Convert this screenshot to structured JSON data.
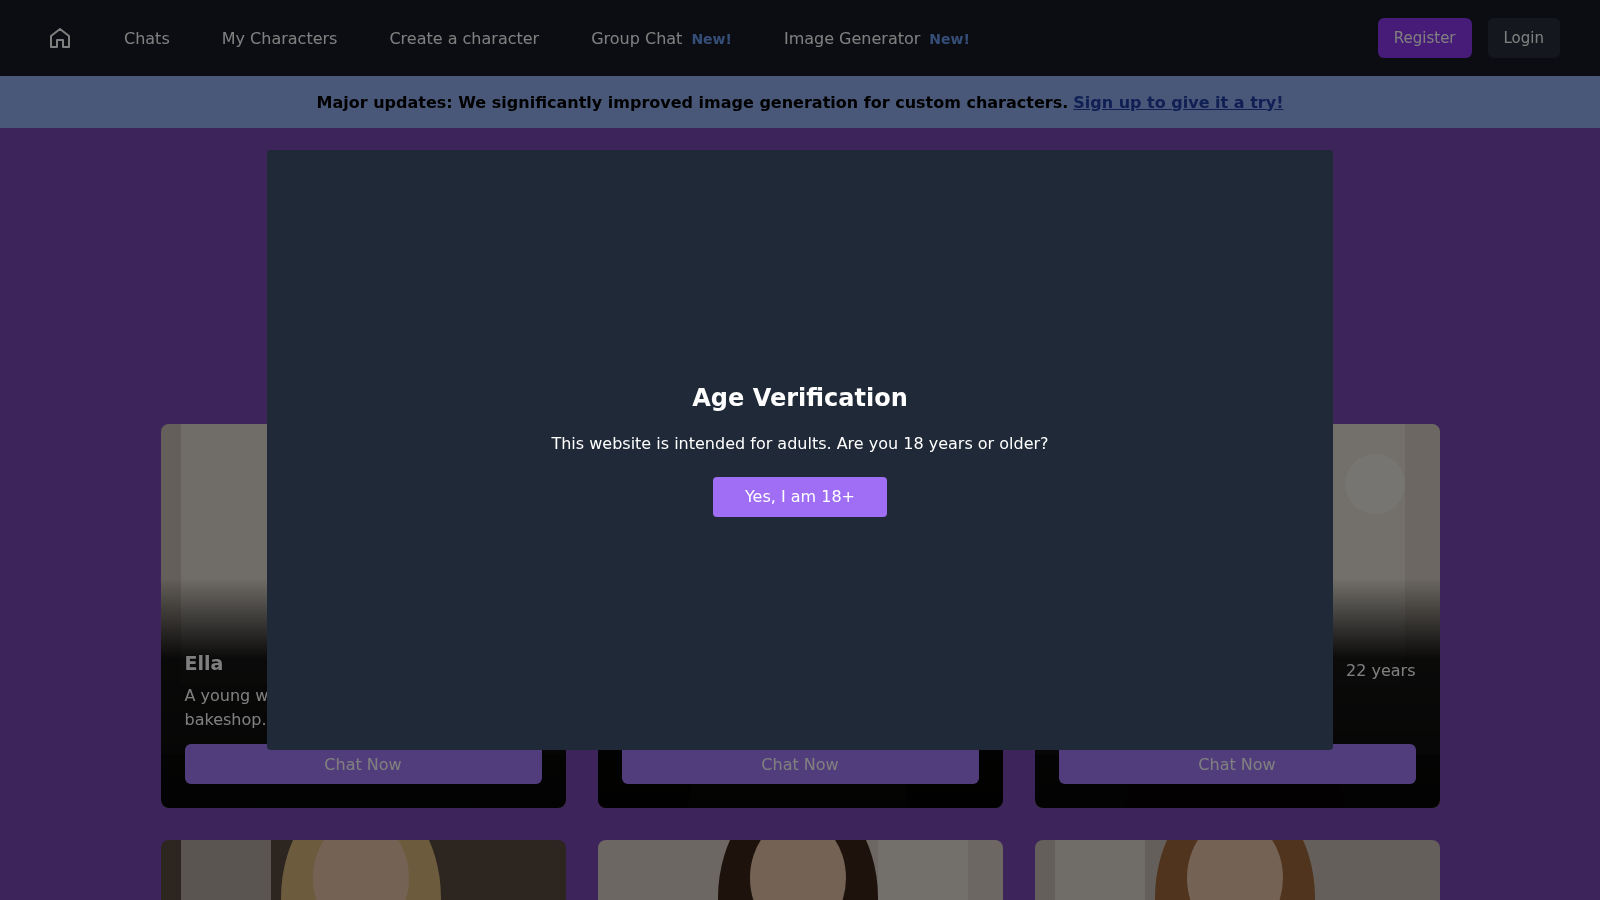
{
  "nav": {
    "links": [
      {
        "label": "Chats"
      },
      {
        "label": "My Characters"
      },
      {
        "label": "Create a character"
      },
      {
        "label": "Group Chat",
        "badge": "New!"
      },
      {
        "label": "Image Generator",
        "badge": "New!"
      }
    ],
    "register": "Register",
    "login": "Login"
  },
  "banner": {
    "text": "Major updates: We significantly improved image generation for custom characters.",
    "link": "Sign up to give it a try!"
  },
  "cards": [
    {
      "name": "Ella",
      "description_lines": [
        "A young w",
        "bakeshop."
      ],
      "button": "Chat Now"
    },
    {
      "button": "Chat Now"
    },
    {
      "age": "22 years",
      "button": "Chat Now"
    }
  ],
  "modal": {
    "title": "Age Verification",
    "message": "This website is intended for adults. Are you 18 years or older?",
    "button": "Yes, I am 18+"
  }
}
